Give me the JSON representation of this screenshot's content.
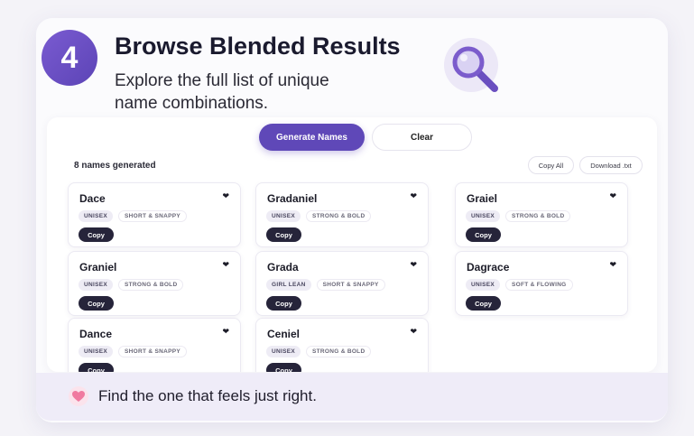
{
  "step": {
    "number": "4"
  },
  "header": {
    "title": "Browse Blended Results",
    "subtitle": "Explore the full list of unique name combinations."
  },
  "actions": {
    "generate_label": "Generate Names",
    "clear_label": "Clear",
    "copy_all_label": "Copy All",
    "download_label": "Download .txt"
  },
  "results": {
    "count_text": "8 names generated",
    "copy_label": "Copy",
    "items": [
      {
        "name": "Dace",
        "gender": "UNISEX",
        "style": "SHORT & SNAPPY"
      },
      {
        "name": "Gradaniel",
        "gender": "UNISEX",
        "style": "STRONG & BOLD"
      },
      {
        "name": "Graiel",
        "gender": "UNISEX",
        "style": "STRONG & BOLD"
      },
      {
        "name": "Graniel",
        "gender": "UNISEX",
        "style": "STRONG & BOLD"
      },
      {
        "name": "Grada",
        "gender": "GIRL LEAN",
        "style": "SHORT & SNAPPY"
      },
      {
        "name": "Dagrace",
        "gender": "UNISEX",
        "style": "SOFT & FLOWING"
      },
      {
        "name": "Dance",
        "gender": "UNISEX",
        "style": "SHORT & SNAPPY"
      },
      {
        "name": "Ceniel",
        "gender": "UNISEX",
        "style": "STRONG & BOLD"
      }
    ]
  },
  "footer": {
    "text": "Find the one that feels just right."
  },
  "icons": {
    "heart": "heart-icon",
    "search": "magnifier-icon",
    "footer_heart": "pink-heart-icon"
  },
  "colors": {
    "accent": "#5f48b8",
    "copy_button": "#26243a",
    "footer_bg": "#efecf8",
    "heart_pink": "#f07aa0"
  }
}
